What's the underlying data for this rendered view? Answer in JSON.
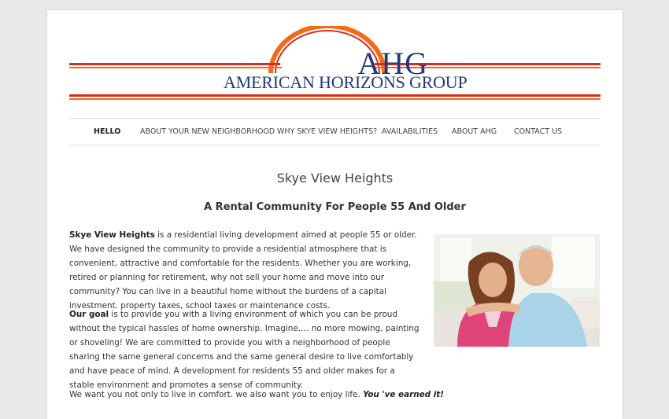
{
  "logo": {
    "abbr": "AHG",
    "name": "AMERICAN HORIZONS GROUP",
    "colors": {
      "navy": "#1f3b7a",
      "red": "#d92b1d",
      "orange": "#f26a1b"
    }
  },
  "nav": {
    "items": [
      {
        "label": "HELLO",
        "active": true
      },
      {
        "label": "ABOUT YOUR NEW NEIGHBORHOOD"
      },
      {
        "label": "WHY SKYE VIEW HEIGHTS?"
      },
      {
        "label": "AVAILABILITIES"
      },
      {
        "label": "ABOUT AHG"
      },
      {
        "label": "CONTACT US"
      }
    ]
  },
  "content": {
    "title": "Skye View Heights",
    "subtitle": "A Rental Community For People 55 And Older",
    "p1": {
      "bold": "Skye View Heights",
      "text": " is a residential living development aimed at people 55 or older. We have designed the community to provide a residential atmosphere that is convenient, attractive and comfortable for the residents. Whether you are working, retired or planning for retirement, why not sell your home and move into our community? You can live in a beautiful home without the burdens of a capital investment. property taxes, school taxes or maintenance costs."
    },
    "p2": {
      "bold": "Our goal",
      "text": " is to provide you with a living environment of which you can be proud without the typical hassles of home ownership. Imagine…. no more mowing, painting or shoveling! We are committed to provide you with a neighborhood of people sharing the same general concerns and the same general desire to live comfortably and have peace of mind. A development for residents 55 and older makes for a stable environment and promotes a sense of community."
    },
    "p3": {
      "text": "We want you not only to live in comfort. we also want you to enjoy life. ",
      "emph": "You 've earned it!"
    },
    "photo_icon": "senior-couple-photo"
  }
}
